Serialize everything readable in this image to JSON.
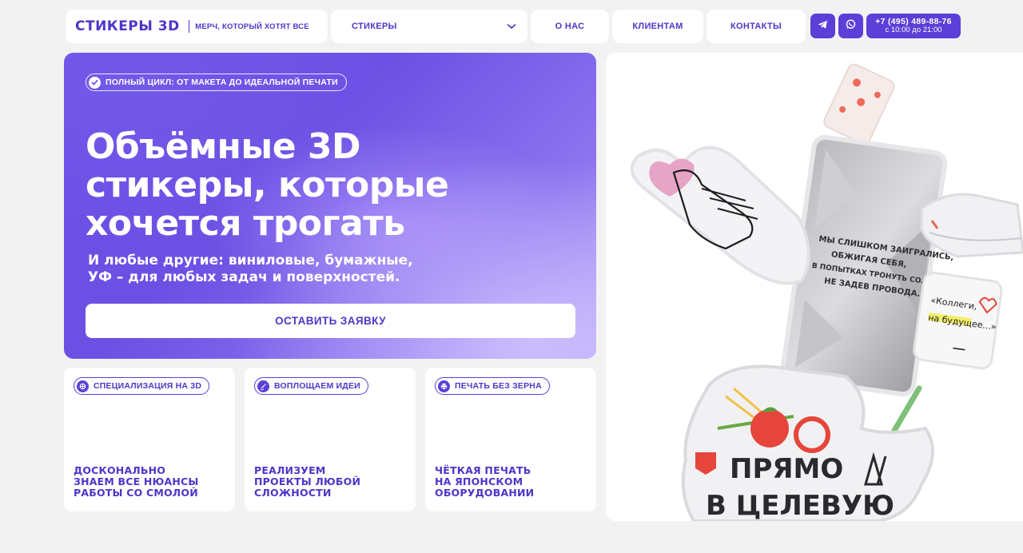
{
  "nav": {
    "logo": "СТИКЕРЫ 3D",
    "tagline": "МЕРЧ, КОТОРЫЙ ХОТЯТ ВСЕ",
    "dropdown_label": "СТИКЕРЫ",
    "links": [
      "О НАС",
      "КЛИЕНТАМ",
      "КОНТАКТЫ"
    ],
    "phone": "+7 (495) 489-88-76",
    "hours": "с 10:00 до 21:00",
    "social": [
      "telegram-icon",
      "whatsapp-icon"
    ]
  },
  "hero": {
    "badge": "ПОЛНЫЙ ЦИКЛ: ОТ МАКЕТА ДО ИДЕАЛЬНОЙ ПЕЧАТИ",
    "title_lines": [
      "Объёмные 3D",
      "стикеры, которые",
      "хочется трогать"
    ],
    "subtitle_lines": [
      "И любые другие: виниловые, бумажные,",
      "УФ – для любых задач и поверхностей."
    ],
    "cta": "ОСТАВИТЬ ЗАЯВКУ"
  },
  "features": [
    {
      "tag": "СПЕЦИАЛИЗАЦИЯ НА 3D",
      "icon": "drop-icon",
      "lines": [
        "ДОСКОНАЛЬНО",
        "ЗНАЕМ ВСЕ НЮАНСЫ",
        "РАБОТЫ СО СМОЛОЙ"
      ]
    },
    {
      "tag": "ВОПЛОЩАЕМ ИДЕИ",
      "icon": "brush-icon",
      "lines": [
        "РЕАЛИЗУЕМ",
        "ПРОЕКТЫ ЛЮБОЙ",
        "СЛОЖНОСТИ"
      ]
    },
    {
      "tag": "ПЕЧАТЬ БЕЗ ЗЕРНА",
      "icon": "printer-icon",
      "lines": [
        "ЧЁТКАЯ ПЕЧАТЬ",
        "НА ЯПОНСКОМ",
        "ОБОРУДОВАНИИ"
      ]
    }
  ],
  "stickers": {
    "square_text": [
      "МЫ СЛИШКОМ ЗАИГРАЛИСЬ,",
      "ОБЖИГАЯ СЕБЯ,",
      "В ПОПЫТКАХ ТРОНУТЬ СОЛНЦЕ,",
      "НЕ ЗАДЕВ ПРОВОДА."
    ],
    "note_text": [
      "«Коллеги,",
      "на будущее...»"
    ],
    "big_text": [
      "ПРЯМО",
      "В ЦЕЛЕВУЮ"
    ]
  },
  "colors": {
    "accent": "#5b3fd8",
    "background": "#f2f2f3"
  }
}
